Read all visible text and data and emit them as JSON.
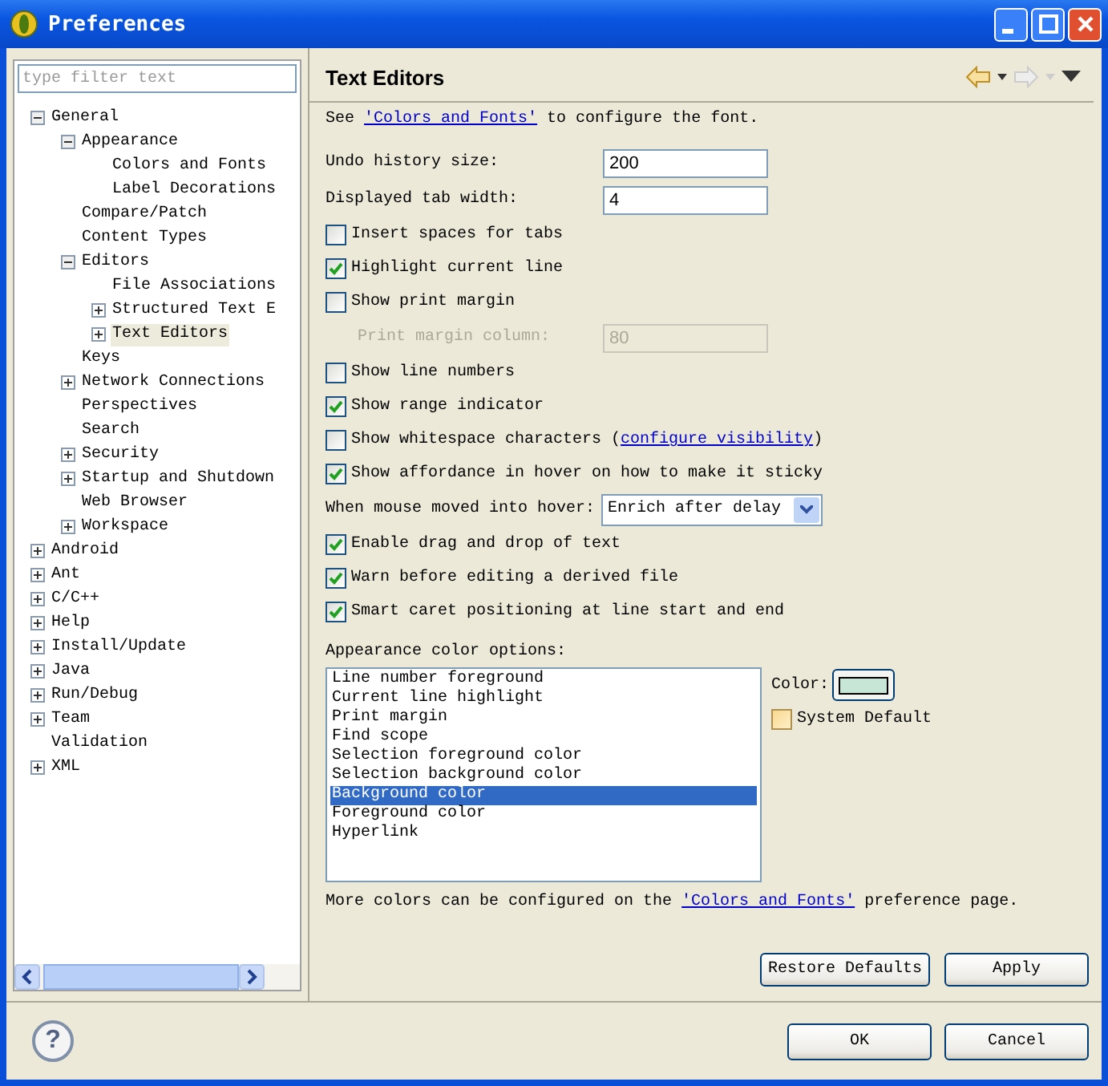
{
  "window": {
    "title": "Preferences"
  },
  "filter": {
    "placeholder": "type filter text"
  },
  "tree": [
    {
      "label": "General",
      "kind": "folder",
      "expanded": true,
      "selected": false,
      "children": [
        {
          "label": "Appearance",
          "kind": "folder",
          "expanded": true,
          "selected": false,
          "children": [
            {
              "label": "Colors and Fonts",
              "kind": "leaf",
              "selected": false
            },
            {
              "label": "Label Decorations",
              "kind": "leaf",
              "selected": false
            }
          ]
        },
        {
          "label": "Compare/Patch",
          "kind": "leaf",
          "selected": false
        },
        {
          "label": "Content Types",
          "kind": "leaf",
          "selected": false
        },
        {
          "label": "Editors",
          "kind": "folder",
          "expanded": true,
          "selected": false,
          "children": [
            {
              "label": "File Associations",
              "kind": "leaf",
              "selected": false
            },
            {
              "label": "Structured Text E",
              "kind": "folder",
              "expanded": false,
              "selected": false
            },
            {
              "label": "Text Editors",
              "kind": "folder",
              "expanded": false,
              "selected": true
            }
          ]
        },
        {
          "label": "Keys",
          "kind": "leaf",
          "selected": false
        },
        {
          "label": "Network Connections",
          "kind": "folder",
          "expanded": false,
          "selected": false
        },
        {
          "label": "Perspectives",
          "kind": "leaf",
          "selected": false
        },
        {
          "label": "Search",
          "kind": "leaf",
          "selected": false
        },
        {
          "label": "Security",
          "kind": "folder",
          "expanded": false,
          "selected": false
        },
        {
          "label": "Startup and Shutdown",
          "kind": "folder",
          "expanded": false,
          "selected": false
        },
        {
          "label": "Web Browser",
          "kind": "leaf",
          "selected": false
        },
        {
          "label": "Workspace",
          "kind": "folder",
          "expanded": false,
          "selected": false
        }
      ]
    },
    {
      "label": "Android",
      "kind": "folder",
      "expanded": false,
      "selected": false
    },
    {
      "label": "Ant",
      "kind": "folder",
      "expanded": false,
      "selected": false
    },
    {
      "label": "C/C++",
      "kind": "folder",
      "expanded": false,
      "selected": false
    },
    {
      "label": "Help",
      "kind": "folder",
      "expanded": false,
      "selected": false
    },
    {
      "label": "Install/Update",
      "kind": "folder",
      "expanded": false,
      "selected": false
    },
    {
      "label": "Java",
      "kind": "folder",
      "expanded": false,
      "selected": false
    },
    {
      "label": "Run/Debug",
      "kind": "folder",
      "expanded": false,
      "selected": false
    },
    {
      "label": "Team",
      "kind": "folder",
      "expanded": false,
      "selected": false
    },
    {
      "label": "Validation",
      "kind": "leaf",
      "selected": false
    },
    {
      "label": "XML",
      "kind": "folder",
      "expanded": false,
      "selected": false
    }
  ],
  "page": {
    "title": "Text Editors",
    "intro": {
      "before": "See ",
      "link": "'Colors and Fonts'",
      "after": " to configure the font."
    },
    "settings": [
      {
        "kind": "field",
        "label": "Undo history size:",
        "value": "200",
        "disabled": false
      },
      {
        "kind": "field",
        "label": "Displayed tab width:",
        "value": "4",
        "disabled": false
      },
      {
        "kind": "checkbox",
        "label": "Insert spaces for tabs",
        "checked": false
      },
      {
        "kind": "checkbox",
        "label": "Highlight current line",
        "checked": true
      },
      {
        "kind": "checkbox",
        "label": "Show print margin",
        "checked": false
      },
      {
        "kind": "field",
        "label": "Print margin column:",
        "value": "80",
        "disabled": true
      },
      {
        "kind": "checkbox",
        "label": "Show line numbers",
        "checked": false
      },
      {
        "kind": "checkbox",
        "label": "Show range indicator",
        "checked": true
      },
      {
        "kind": "checkbox",
        "label": "Show whitespace characters (",
        "link": "configure visibility",
        "after": ")",
        "checked": false
      },
      {
        "kind": "checkbox",
        "label": "Show affordance in hover on how to make it sticky",
        "checked": true
      },
      {
        "kind": "select",
        "label": "When mouse moved into hover:",
        "value": "Enrich after delay"
      },
      {
        "kind": "checkbox",
        "label": "Enable drag and drop of text",
        "checked": true
      },
      {
        "kind": "checkbox",
        "label": "Warn before editing a derived file",
        "checked": true
      },
      {
        "kind": "checkbox",
        "label": "Smart caret positioning at line start and end",
        "checked": true
      }
    ],
    "color_options": {
      "label": "Appearance color options:",
      "items": [
        {
          "label": "Line number foreground",
          "selected": false
        },
        {
          "label": "Current line highlight",
          "selected": false
        },
        {
          "label": "Print margin",
          "selected": false
        },
        {
          "label": "Find scope",
          "selected": false
        },
        {
          "label": "Selection foreground color",
          "selected": false
        },
        {
          "label": "Selection background color",
          "selected": false
        },
        {
          "label": "Background color",
          "selected": true
        },
        {
          "label": "Foreground color",
          "selected": false
        },
        {
          "label": "Hyperlink",
          "selected": false
        }
      ],
      "color_label": "Color:",
      "system_default": {
        "label": "System Default",
        "checked": false
      }
    },
    "footer": {
      "before": "More colors can be configured on the ",
      "link": "'Colors and Fonts'",
      "after": " preference page."
    },
    "buttons": [
      "Restore Defaults",
      "Apply"
    ]
  },
  "dialog_buttons": [
    "OK",
    "Cancel"
  ],
  "help_button": "?"
}
